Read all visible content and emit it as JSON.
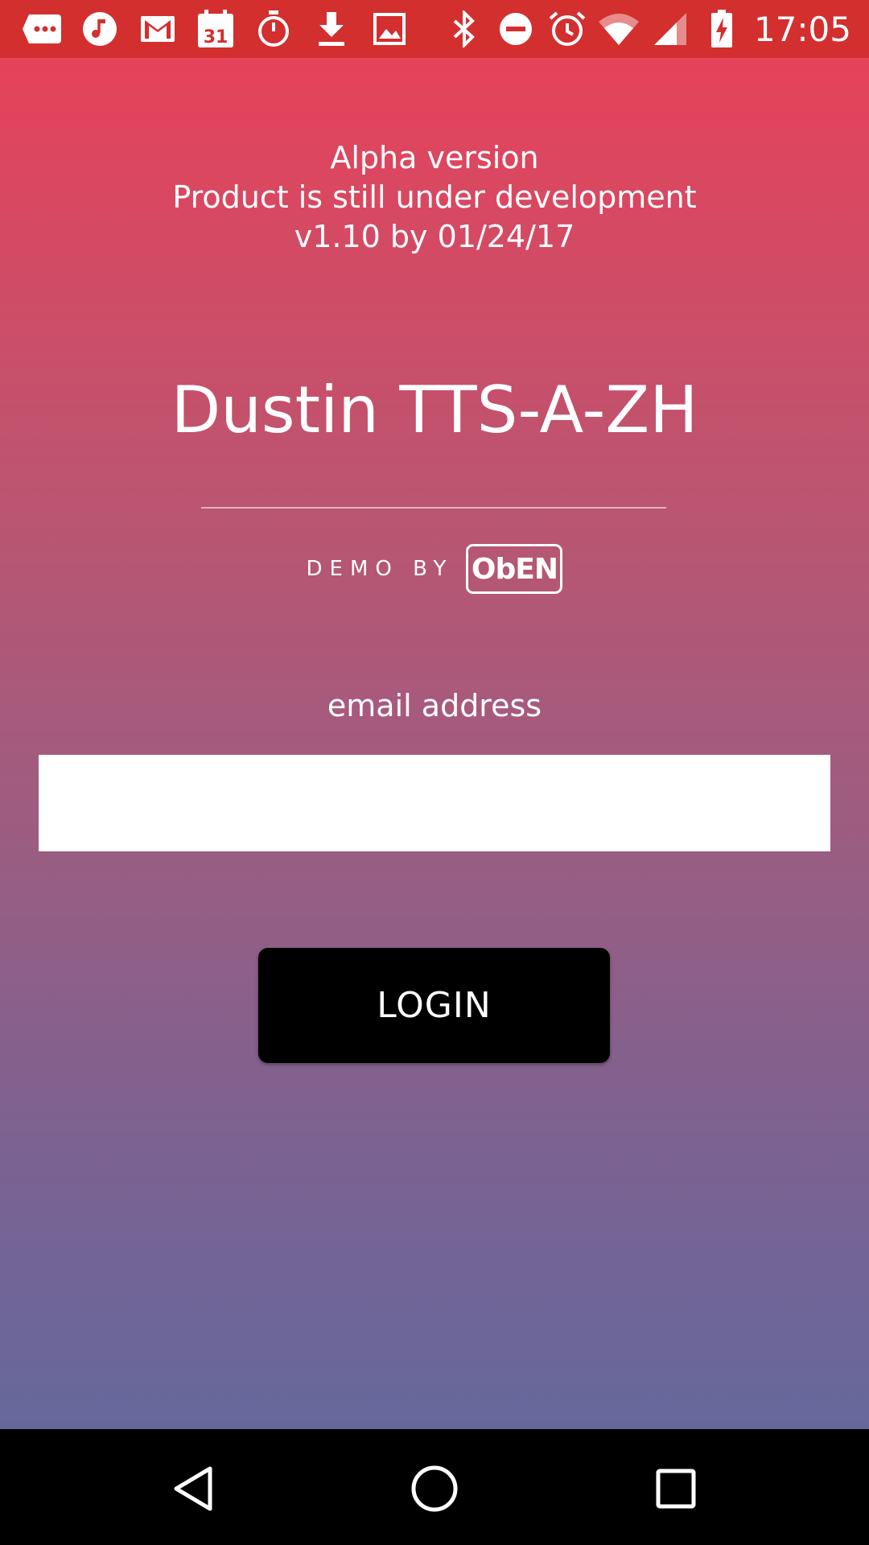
{
  "status_bar": {
    "time": "17:05",
    "calendar_day": "31",
    "left_icons": [
      "chat-bubble-icon",
      "music-note-icon",
      "gmail-icon",
      "calendar-icon",
      "timer-icon",
      "download-icon",
      "image-icon"
    ],
    "right_icons": [
      "bluetooth-icon",
      "do-not-disturb-icon",
      "alarm-icon",
      "wifi-icon",
      "signal-icon",
      "battery-charging-icon"
    ],
    "color": "#d32f2f"
  },
  "notice": {
    "line1": "Alpha version",
    "line2": "Product is still under development",
    "line3": "v1.10 by 01/24/17"
  },
  "app": {
    "title": "Dustin TTS-A-ZH",
    "demo_label": "DEMO BY",
    "logo_text": "ObEN"
  },
  "form": {
    "email_label": "email address",
    "email_value": "",
    "login_label": "LOGIN"
  },
  "nav_bar": {
    "icons": [
      "back-icon",
      "home-icon",
      "recents-icon"
    ]
  },
  "colors": {
    "gradient_top": "#e6425a",
    "gradient_bottom": "#66689c",
    "button": "#000000"
  }
}
